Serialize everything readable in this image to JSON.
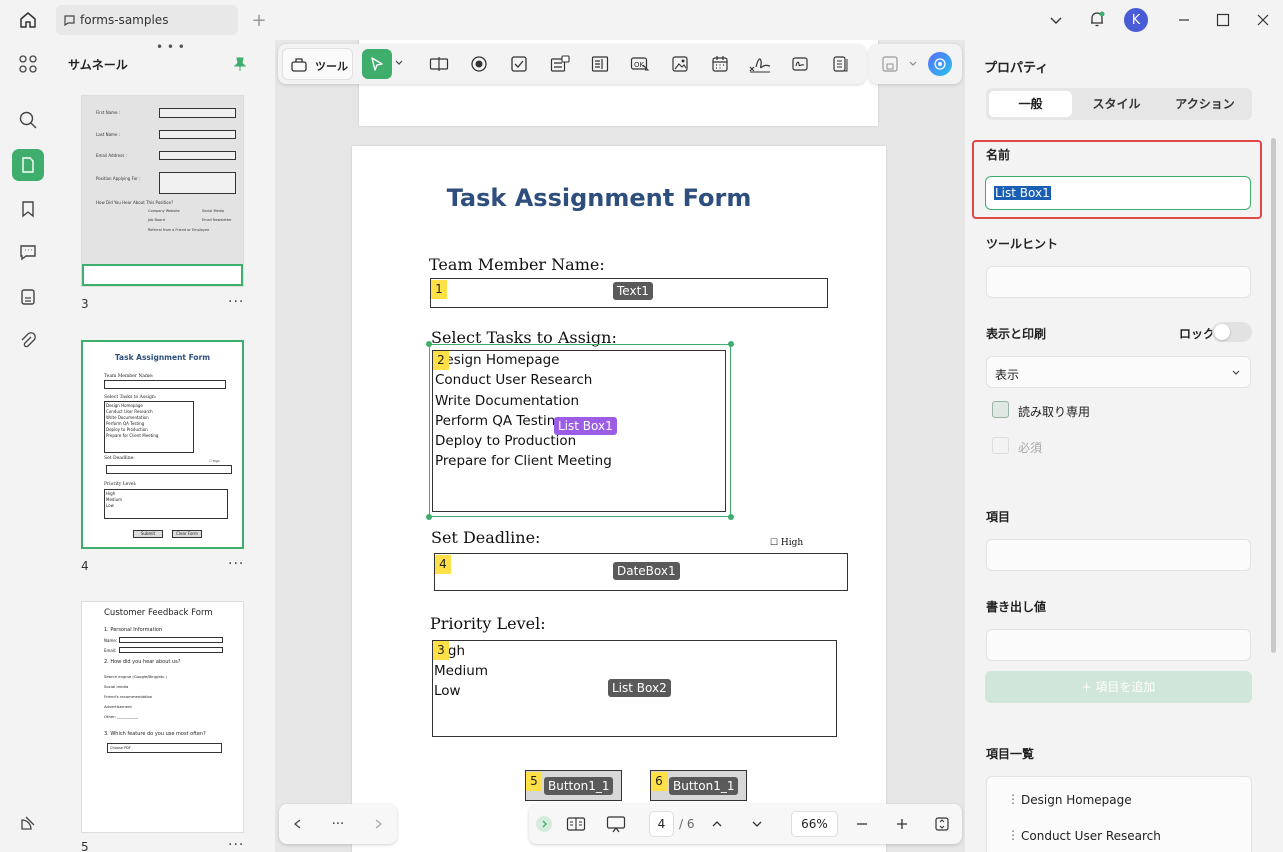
{
  "titlebar": {
    "tab_title": "forms-samples",
    "user_initial": "K"
  },
  "thumbnails": {
    "header": "サムネール",
    "pages": [
      {
        "number": "3",
        "mini": {
          "labels": [
            "First Name :",
            "Last Name :",
            "Email Address :",
            "Position Applying For :",
            "How Did You Hear About This Position?"
          ],
          "checks": [
            "Company Website",
            "Social Media",
            "Job Board",
            "Email Newsletter",
            "Referral from a Friend or Employee"
          ]
        }
      },
      {
        "number": "4",
        "mini": {
          "title": "Task Assignment Form",
          "team": "Team Member Name:",
          "select": "Select Tasks to Assign:",
          "items": [
            "Design Homepage",
            "Conduct User Research",
            "Write Documentation",
            "Perform QA Testing",
            "Deploy to Production",
            "Prepare for Client Meeting"
          ],
          "deadline": "Set Deadline:",
          "high": "☐ High",
          "priority": "Priority Level:",
          "prio_items": [
            "High",
            "Medium",
            "Low"
          ],
          "submit": "Submit",
          "clear": "Clear Form"
        }
      },
      {
        "number": "5",
        "mini": {
          "title": "Customer Feedback Form",
          "s1": "1. Personal Information",
          "name": "Name:",
          "email": "Email:",
          "s2": "2. How did you hear about us?",
          "options": [
            "Search engine (Google/Bing/etc.)",
            "Social media",
            "Friend's recommendation",
            "Advertisement",
            "Other: ___________"
          ],
          "s3": "3. Which feature do you use most often?",
          "dropdown": "Choose PDF"
        }
      }
    ]
  },
  "toolbar": {
    "tools_label": "ツール"
  },
  "document": {
    "title": "Task Assignment Form",
    "team_label": "Team Member Name:",
    "tasks_label": "Select Tasks to Assign:",
    "tasks": [
      "Design Homepage",
      "Conduct User Research",
      "Write Documentation",
      "Perform QA Testing",
      "Deploy to Production",
      "Prepare for Client Meeting"
    ],
    "deadline_label": "Set Deadline:",
    "high_checkbox": "☐ High",
    "priority_label": "Priority Level:",
    "priorities": [
      "High",
      "Medium",
      "Low"
    ],
    "fields": {
      "text1": {
        "order": "1",
        "name": "Text1"
      },
      "listbox1": {
        "order": "2",
        "name": "List Box1"
      },
      "datebox1": {
        "order": "4",
        "name": "DateBox1"
      },
      "listbox2": {
        "order": "3",
        "name": "List Box2"
      },
      "button_a": {
        "order": "5",
        "name": "Button1_1"
      },
      "button_b": {
        "order": "6",
        "name": "Button1_1"
      }
    }
  },
  "bottombar": {
    "current_page": "4",
    "total_pages": "/ 6",
    "zoom": "66%"
  },
  "properties": {
    "title": "プロパティ",
    "tabs": [
      "一般",
      "スタイル",
      "アクション"
    ],
    "active_tab": 0,
    "name_label": "名前",
    "name_value": "List Box1",
    "tooltip_label": "ツールヒント",
    "tooltip_value": "",
    "visibility_label": "表示と印刷",
    "lock_label": "ロック",
    "visibility_value": "表示",
    "readonly_label": "読み取り専用",
    "required_label": "必須",
    "item_label": "項目",
    "item_value": "",
    "export_label": "書き出し値",
    "export_value": "",
    "add_item_label": "+ 項目を追加",
    "items_list_label": "項目一覧",
    "items_list": [
      "Design Homepage",
      "Conduct User Research"
    ]
  },
  "colors": {
    "accent_green": "#3fae6c",
    "highlight_red": "#e04848",
    "field_tag": "#5a5a5a",
    "selected_tag": "#9b5de5",
    "number_tag": "#ffe046",
    "title_blue": "#2e4e7e"
  }
}
